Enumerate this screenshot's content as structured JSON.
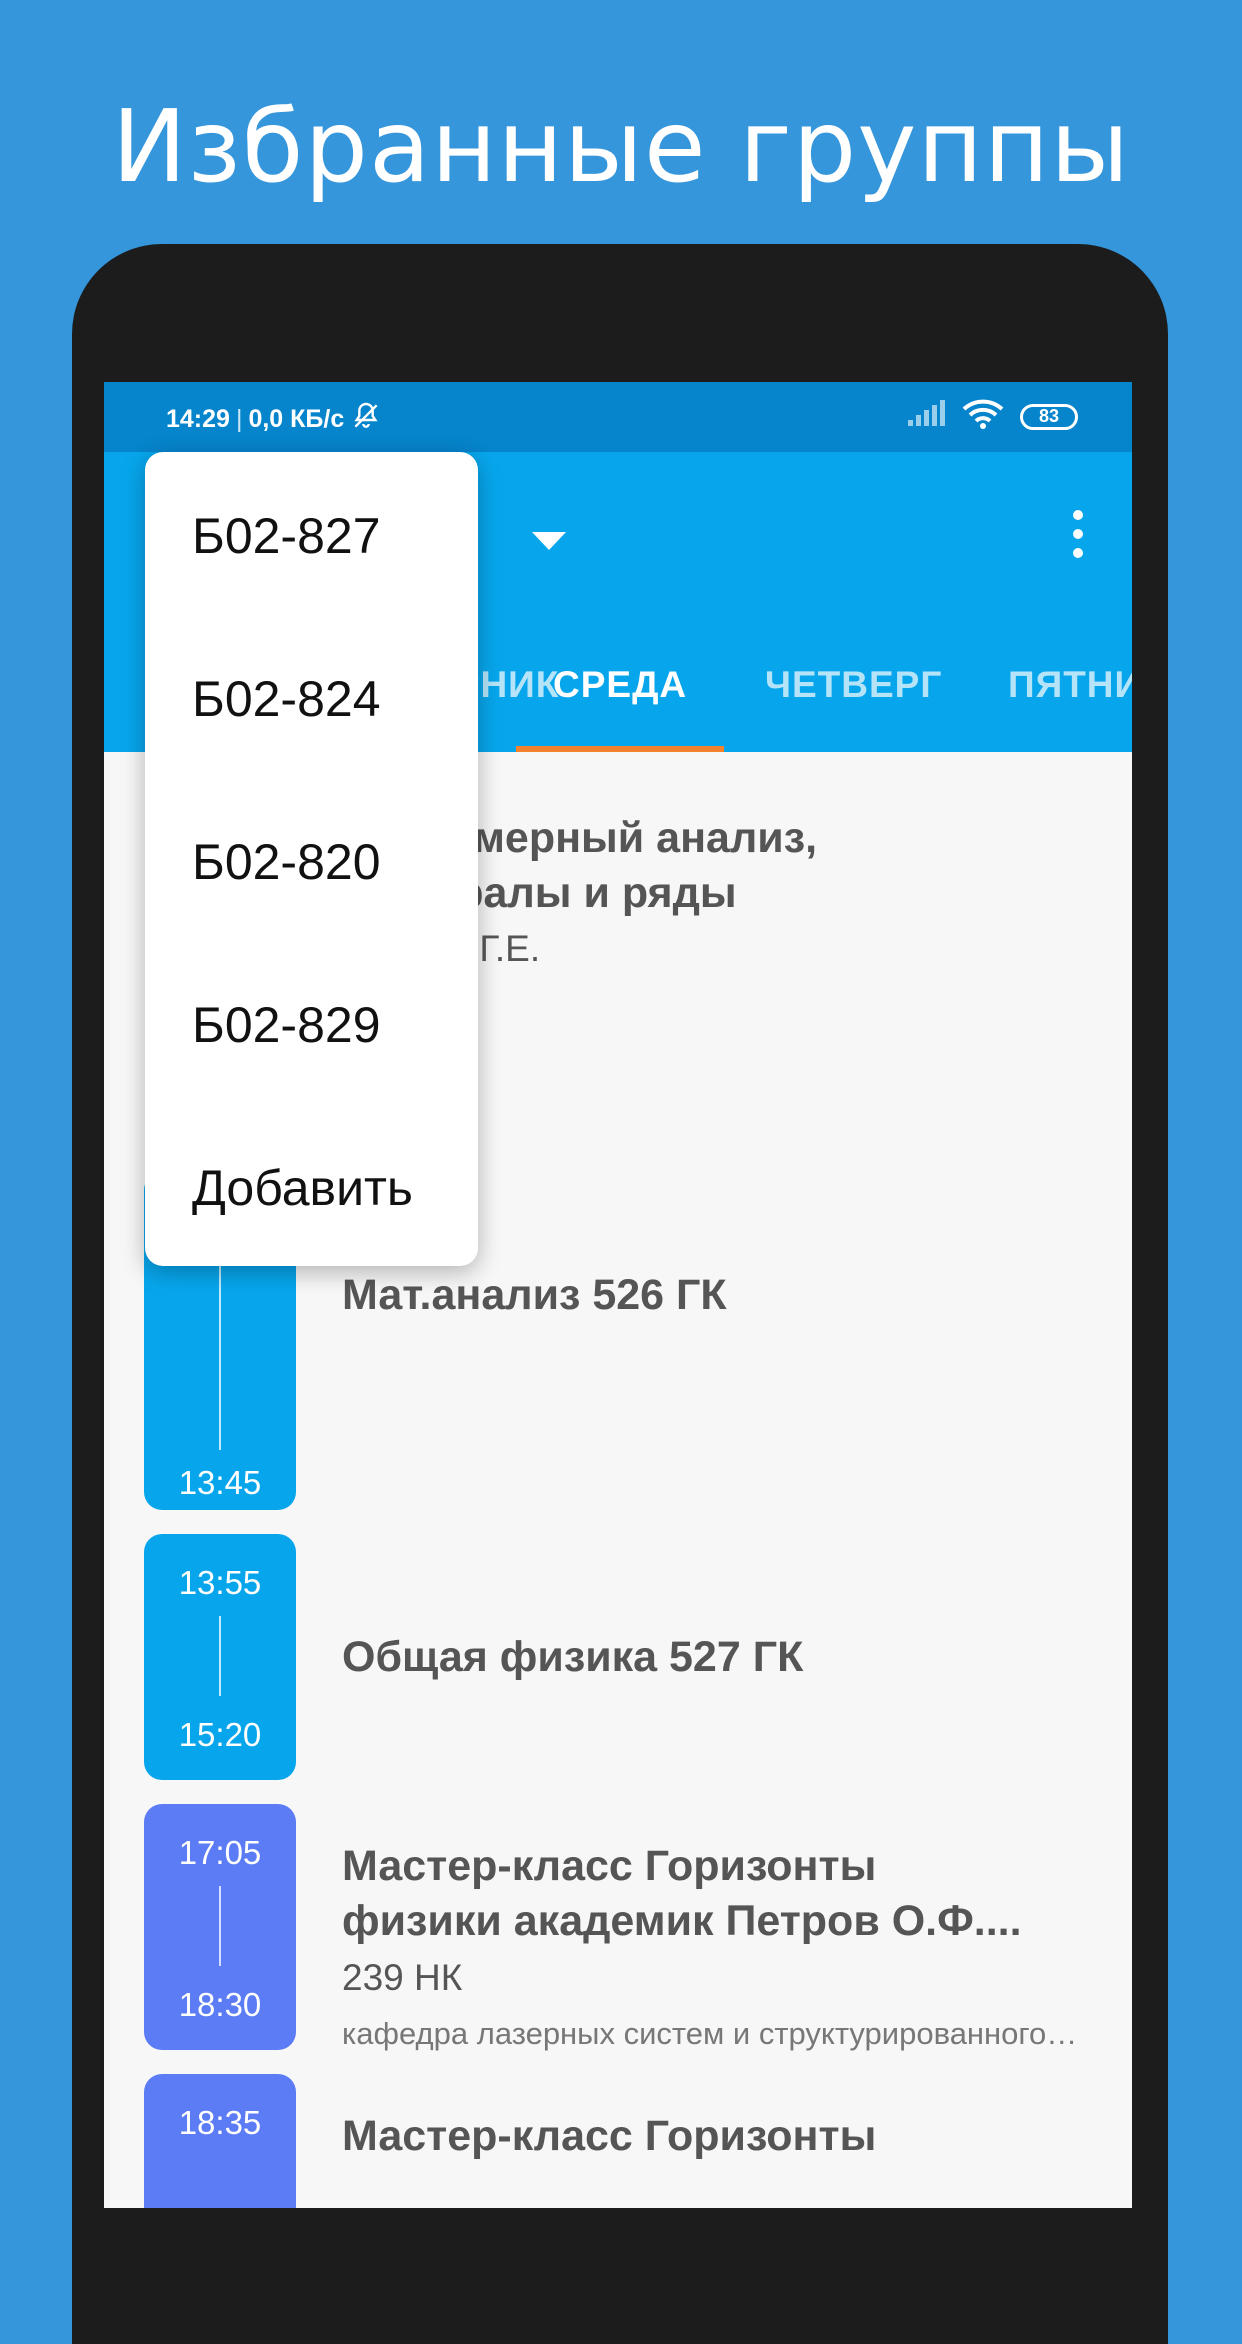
{
  "promo": {
    "title": "Избранные группы"
  },
  "statusbar": {
    "time": "14:29",
    "separator": "|",
    "speed": "0,0 КБ/с",
    "battery": "83"
  },
  "appbar": {
    "dropdown_icon": "caret-down-icon",
    "menu_icon": "more-vert-icon"
  },
  "tabs": [
    {
      "label": "ВТОРНИК",
      "active": false
    },
    {
      "label": "СРЕДА",
      "active": true
    },
    {
      "label": "ЧЕТВЕРГ",
      "active": false
    },
    {
      "label": "ПЯТНИЦА",
      "active": false
    }
  ],
  "lessons": [
    {
      "title_l1": "Многомерный анализ,",
      "title_l2": "интегралы и ряды",
      "teacher": "Иванов Г.Е."
    },
    {
      "end": "13:45",
      "title": "Мат.анализ 526 ГК",
      "color": "#07a6ec"
    },
    {
      "start": "13:55",
      "end": "15:20",
      "title": "Общая физика 527 ГК",
      "color": "#07a6ec"
    },
    {
      "start": "17:05",
      "end": "18:30",
      "title_l1": "Мастер-класс Горизонты",
      "title_l2": "физики академик Петров О.Ф....",
      "room": "239 НК",
      "department": "кафедра лазерных систем и структурированного света",
      "color": "#5b7cf5"
    },
    {
      "start": "18:35",
      "title_l1": "Мастер-класс Горизонты",
      "color": "#5b7cf5"
    }
  ],
  "group_menu": {
    "items": [
      "Б02-827",
      "Б02-824",
      "Б02-820",
      "Б02-829"
    ],
    "add_label": "Добавить"
  }
}
